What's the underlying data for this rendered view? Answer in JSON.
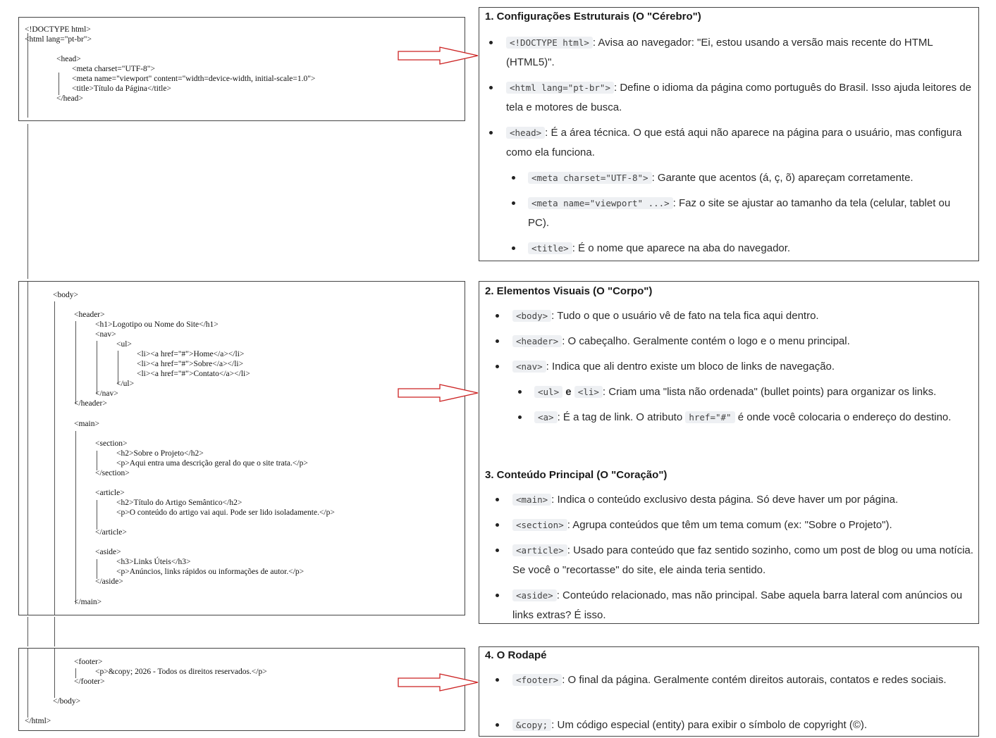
{
  "code_block_1": {
    "lines": [
      "<!DOCTYPE html>",
      "<html lang=\"pt-br\">",
      "<head>",
      "<meta charset=\"UTF-8\">",
      "<meta name=\"viewport\" content=\"width=device-width, initial-scale=1.0\">",
      "<title>Título da Página</title>",
      "</head>"
    ]
  },
  "code_block_2": {
    "lines": [
      "<body>",
      "<header>",
      "<h1>Logotipo ou Nome do Site</h1>",
      "<nav>",
      "<ul>",
      "<li><a href=\"#\">Home</a></li>",
      "<li><a href=\"#\">Sobre</a></li>",
      "<li><a href=\"#\">Contato</a></li>",
      "</ul>",
      "</nav>",
      "</header>",
      "<main>",
      "<section>",
      "<h2>Sobre o Projeto</h2>",
      "<p>Aqui entra uma descrição geral do que o site trata.</p>",
      "</section>",
      "<article>",
      "<h2>Título do Artigo Semântico</h2>",
      "<p>O conteúdo do artigo vai aqui. Pode ser lido isoladamente.</p>",
      "</article>",
      "<aside>",
      "<h3>Links Úteis</h3>",
      "<p>Anúncios, links rápidos ou informações de autor.</p>",
      "</aside>",
      "</main>"
    ]
  },
  "code_block_3": {
    "lines": [
      "<footer>",
      "<p>&copy; 2026 - Todos os direitos reservados.</p>",
      "</footer>",
      "</body>",
      "</html>"
    ]
  },
  "panel_1": {
    "title": "1. Configurações Estruturais (O \"Cérebro\")",
    "items": [
      {
        "code": "<!DOCTYPE html>",
        "text": ": Avisa ao navegador: \"Ei, estou usando a versão mais recente do HTML (HTML5)\"."
      },
      {
        "code": "<html lang=\"pt-br\">",
        "text": ": Define o idioma da página como português do Brasil. Isso ajuda leitores de tela e motores de busca."
      },
      {
        "code": "<head>",
        "text": ": É a área técnica. O que está aqui não aparece na página para o usuário, mas configura como ela funciona."
      },
      {
        "code": "<meta charset=\"UTF-8\">",
        "text": ": Garante que acentos (á, ç, õ) apareçam corretamente."
      },
      {
        "code": "<meta name=\"viewport\" ...>",
        "text": ": Faz o site se ajustar ao tamanho da tela (celular, tablet ou PC)."
      },
      {
        "code": "<title>",
        "text": ": É o nome que aparece na aba do navegador."
      }
    ]
  },
  "panel_2": {
    "title_visual": "2. Elementos Visuais (O \"Corpo\")",
    "visual_items": [
      {
        "code": "<body>",
        "text": ": Tudo o que o usuário vê de fato na tela fica aqui dentro."
      },
      {
        "code": "<header>",
        "text": ": O cabeçalho. Geralmente contém o logo e o menu principal."
      },
      {
        "code": "<nav>",
        "text": ": Indica que ali dentro existe um bloco de links de navegação."
      },
      {
        "code": "<ul>",
        "joiner": " e ",
        "code2": "<li>",
        "text": ": Criam uma \"lista não ordenada\" (bullet points) para organizar os links."
      },
      {
        "code": "<a>",
        "text_pre": ": É a tag de link. O atributo ",
        "code2": "href=\"#\"",
        "text": " é onde você colocaria o endereço do destino."
      }
    ],
    "title_main": "3. Conteúdo Principal (O \"Coração\")",
    "main_items": [
      {
        "code": "<main>",
        "text": ": Indica o conteúdo exclusivo desta página. Só deve haver um por página."
      },
      {
        "code": "<section>",
        "text": ": Agrupa conteúdos que têm um tema comum (ex: \"Sobre o Projeto\")."
      },
      {
        "code": "<article>",
        "text": ": Usado para conteúdo que faz sentido sozinho, como um post de blog ou uma notícia. Se você o \"recortasse\" do site, ele ainda teria sentido."
      },
      {
        "code": "<aside>",
        "text": ": Conteúdo relacionado, mas não principal. Sabe aquela barra lateral com anúncios ou links extras? É isso."
      }
    ]
  },
  "panel_3": {
    "title": "4. O Rodapé",
    "items": [
      {
        "code": "<footer>",
        "text": ": O final da página. Geralmente contém direitos autorais, contatos e redes sociais."
      },
      {
        "code": "&copy;",
        "text": ": Um código especial (entity) para exibir o símbolo de copyright (©)."
      }
    ]
  },
  "colors": {
    "arrow": "#cc2222",
    "code_bg": "#eef0f3",
    "border": "#444444"
  }
}
